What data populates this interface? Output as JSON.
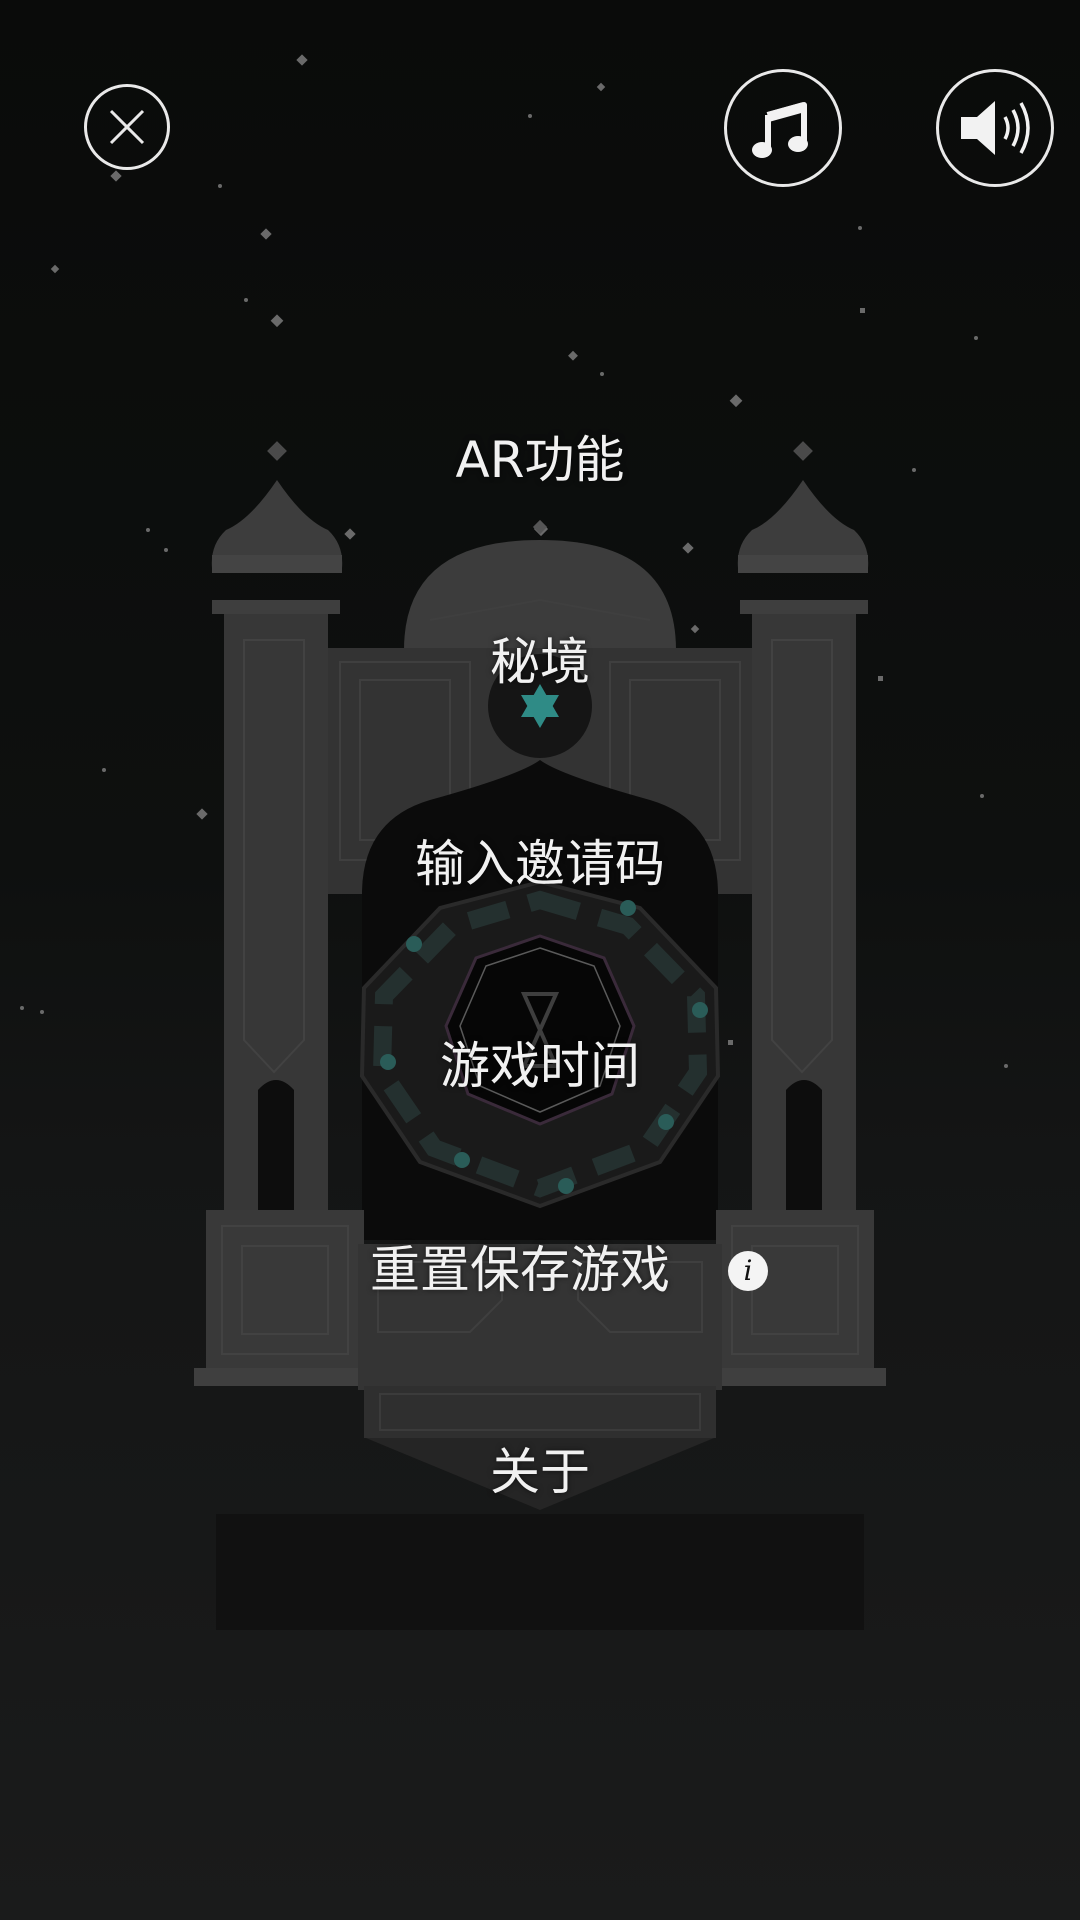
{
  "controls": {
    "close_icon": "close-icon",
    "music_icon": "music-note-icon",
    "sound_icon": "speaker-icon"
  },
  "menu": {
    "ar": "AR功能",
    "secret_realm": "秘境",
    "invite_code": "输入邀请码",
    "play_time": "游戏时间",
    "reset_save": "重置保存游戏",
    "about": "关于"
  },
  "info_button": {
    "label": "i",
    "icon": "info-icon"
  },
  "colors": {
    "background": "#0c0d0c",
    "tower": "#3a3a3a",
    "tower_light": "#444444",
    "text": "#f1f1f1",
    "accent_teal": "#3aa7a0"
  }
}
